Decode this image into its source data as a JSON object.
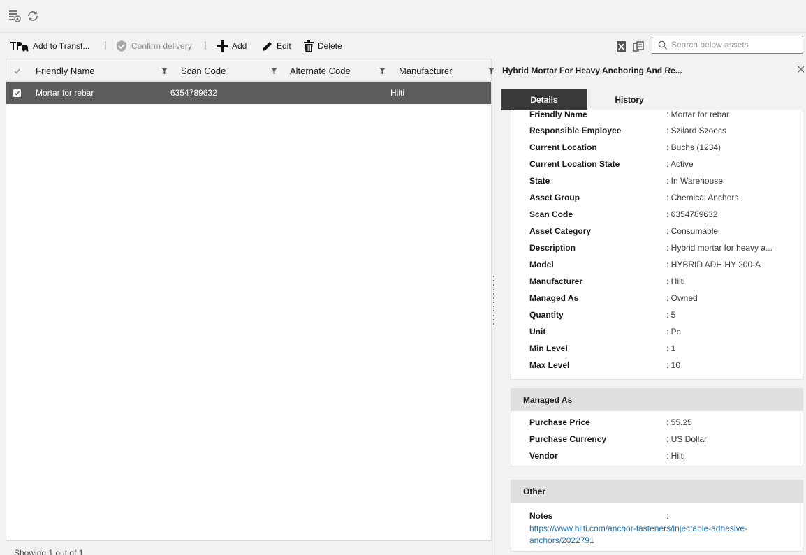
{
  "topbar": {
    "icons": [
      "asset-settings-icon",
      "refresh-icon"
    ]
  },
  "toolbar": {
    "add_transfer_label": "Add to Transf...",
    "confirm_delivery_label": "Confirm delivery",
    "separator": "|",
    "add_label": "Add",
    "edit_label": "Edit",
    "delete_label": "Delete",
    "search_placeholder": "Search below assets"
  },
  "grid": {
    "columns": [
      "Friendly Name",
      "Scan Code",
      "Alternate Code",
      "Manufacturer"
    ],
    "rows": [
      {
        "friendly_name": "Mortar for rebar",
        "scan_code": "6354789632",
        "alternate_code": "",
        "manufacturer": "Hilti",
        "selected": true
      }
    ],
    "footer": "Showing 1 out of 1"
  },
  "panel": {
    "title": "Hybrid Mortar For Heavy Anchoring And Re...",
    "tabs": [
      "Details",
      "History"
    ],
    "active_tab": "Details",
    "details": [
      {
        "label": "Friendly Name",
        "value": ": Mortar for rebar"
      },
      {
        "label": "Responsible Employee",
        "value": ": Szilard Szoecs"
      },
      {
        "label": "Current Location",
        "value": ": Buchs (1234)"
      },
      {
        "label": "Current Location State",
        "value": ": Active"
      },
      {
        "label": "State",
        "value": ": In Warehouse"
      },
      {
        "label": "Asset Group",
        "value": ": Chemical Anchors"
      },
      {
        "label": "Scan Code",
        "value": ": 6354789632"
      },
      {
        "label": "Asset Category",
        "value": ": Consumable"
      },
      {
        "label": "Description",
        "value": ": Hybrid mortar for heavy a..."
      },
      {
        "label": "Model",
        "value": ": HYBRID ADH HY 200-A"
      },
      {
        "label": "Manufacturer",
        "value": ": Hilti"
      },
      {
        "label": "Managed As",
        "value": ": Owned"
      },
      {
        "label": "Quantity",
        "value": ": 5"
      },
      {
        "label": "Unit",
        "value": ": Pc"
      },
      {
        "label": "Min Level",
        "value": ": 1"
      },
      {
        "label": "Max Level",
        "value": ": 10"
      }
    ],
    "managed_as": {
      "header": "Managed As",
      "fields": [
        {
          "label": "Purchase Price",
          "value": ": 55.25"
        },
        {
          "label": "Purchase Currency",
          "value": ": US Dollar"
        },
        {
          "label": "Vendor",
          "value": ": Hilti"
        }
      ]
    },
    "other": {
      "header": "Other",
      "notes_label": "Notes",
      "notes_colon": ":",
      "notes_link_line1": "https://www.hilti.com/anchor-fasteners/injectable-adhesive-",
      "notes_link_line2": "anchors/2022791"
    }
  },
  "colors": {
    "selected_row": "#5c5c5c",
    "active_tab": "#3a3a3a",
    "link": "#1a6fb5"
  }
}
